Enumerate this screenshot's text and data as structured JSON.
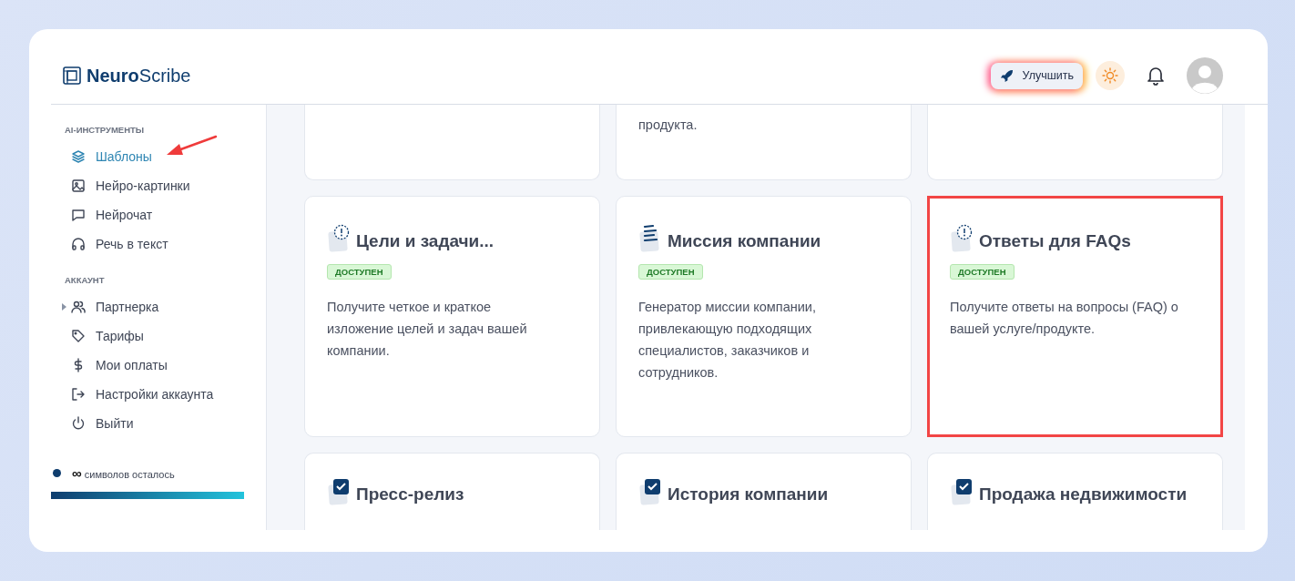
{
  "header": {
    "logo_bold": "Neuro",
    "logo_light": "Scribe",
    "upgrade_button": "Улучшить"
  },
  "sidebar": {
    "sections": [
      {
        "title": "AI-ИНСТРУМЕНТЫ",
        "items": [
          {
            "label": "Шаблоны",
            "kind": "layers",
            "selected": true,
            "pointed": true
          },
          {
            "label": "Нейро-картинки",
            "kind": "image",
            "selected": false,
            "pointed": false
          },
          {
            "label": "Нейрочат",
            "kind": "chat",
            "selected": false,
            "pointed": false
          },
          {
            "label": "Речь в текст",
            "kind": "headphones",
            "selected": false,
            "pointed": false
          }
        ]
      },
      {
        "title": "АККАУНТ",
        "items": [
          {
            "label": "Партнерка",
            "kind": "users",
            "selected": false,
            "pointed": false,
            "expanded": false
          },
          {
            "label": "Тарифы",
            "kind": "tag",
            "selected": false,
            "pointed": false
          },
          {
            "label": "Мои оплаты",
            "kind": "dollar",
            "selected": false,
            "pointed": false
          },
          {
            "label": "Настройки аккаунта",
            "kind": "logout",
            "selected": false,
            "pointed": false
          },
          {
            "label": "Выйти",
            "kind": "power",
            "selected": false,
            "pointed": false
          }
        ]
      }
    ],
    "balance": {
      "text": "**∞** символов осталось",
      "level": 1
    }
  },
  "cards_top_row": [
    {
      "kind": "blank"
    },
    {
      "kind": "text",
      "text": "продукта."
    },
    {
      "kind": "blank"
    }
  ],
  "cards": [
    {
      "kind": "alert",
      "title": "Цели и задачи...",
      "badge": "ДОСТУПЕН",
      "description": "Получите четкое и краткое изложение целей и задач вашей компании.",
      "highlighted": false
    },
    {
      "kind": "lines",
      "title": "Миссия компании",
      "badge": "ДОСТУПЕН",
      "description": "Генератор миссии компании, привлекающую подходящих специалистов, заказчиков и сотрудников.",
      "highlighted": false
    },
    {
      "kind": "alert",
      "title": "Ответы для FAQs",
      "badge": "ДОСТУПЕН",
      "description": "Получите ответы на вопросы (FAQ) о вашей услуге/продукте.",
      "highlighted": true
    }
  ],
  "cards_bottom_row": [
    {
      "kind": "check",
      "title": "Пресс-релиз"
    },
    {
      "kind": "check",
      "title": "История компании"
    },
    {
      "kind": "check",
      "title": "Продажа недвижимости"
    }
  ]
}
